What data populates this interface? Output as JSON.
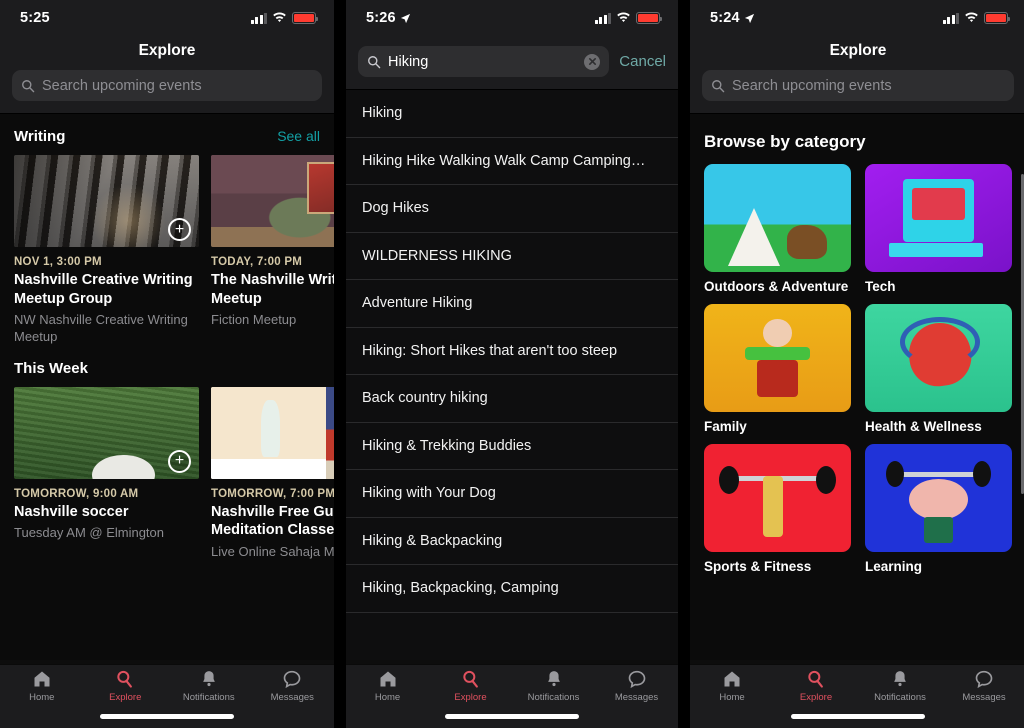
{
  "meta": {
    "app": "Meetup",
    "accent_red": "#e0515f",
    "accent_teal": "#13a0a5",
    "background": "#0b0b0b",
    "chrome": "#1c1c1e"
  },
  "panels": [
    {
      "id": "explore-home",
      "status": {
        "time": "5:25",
        "location_arrow": false,
        "signal": "cellular-icon",
        "wifi": "wifi-icon",
        "battery": "battery-low-icon"
      },
      "header": {
        "title": "Explore"
      },
      "search": {
        "placeholder": "Search upcoming events",
        "value": "",
        "icon": "search-icon"
      },
      "sections": [
        {
          "title": "Writing",
          "see_all": "See all",
          "cards": [
            {
              "when": "NOV 1, 3:00 PM",
              "title": "Nashville Creative Writing Meetup Group",
              "group": "NW Nashville Creative Writing Meetup",
              "art": "art-books",
              "has_add": true,
              "add_icon": "plus-circle-icon"
            },
            {
              "when": "TODAY, 7:00 PM",
              "title": "The Nashville Writing Meetup",
              "group": "Fiction Meetup",
              "art": "art-man",
              "has_add": false,
              "add_icon": "plus-circle-icon"
            }
          ]
        },
        {
          "title": "This Week",
          "see_all": "",
          "cards": [
            {
              "when": "TOMORROW, 9:00 AM",
              "title": "Nashville soccer",
              "group": "Tuesday AM @ Elmington",
              "art": "art-grass",
              "has_add": true,
              "add_icon": "plus-circle-icon"
            },
            {
              "when": "TOMORROW, 7:00 PM",
              "title": "Nashville Free Guided Meditation Classes",
              "group": "Live Online Sahaja M",
              "art": "art-yoga",
              "has_add": false,
              "add_icon": "plus-circle-icon"
            }
          ]
        }
      ],
      "tabbar": [
        {
          "label": "Home",
          "icon": "home-icon",
          "active": false
        },
        {
          "label": "Explore",
          "icon": "search-icon",
          "active": true
        },
        {
          "label": "Notifications",
          "icon": "bell-icon",
          "active": false
        },
        {
          "label": "Messages",
          "icon": "chat-bubble-icon",
          "active": false
        }
      ]
    },
    {
      "id": "search-suggestions",
      "status": {
        "time": "5:26",
        "location_arrow": true,
        "signal": "cellular-icon",
        "wifi": "wifi-icon",
        "battery": "battery-low-icon"
      },
      "header": {
        "title": ""
      },
      "search": {
        "placeholder": "Search upcoming events",
        "value": "Hiking",
        "icon": "search-icon",
        "clear_icon": "clear-circle-icon",
        "cancel_label": "Cancel"
      },
      "suggestions": [
        "Hiking",
        "Hiking Hike Walking Walk Camp Camping…",
        "Dog Hikes",
        "WILDERNESS HIKING",
        "Adventure Hiking",
        "Hiking: Short Hikes that aren't too steep",
        "Back country hiking",
        "Hiking & Trekking Buddies",
        "Hiking with Your Dog",
        "Hiking & Backpacking",
        "Hiking, Backpacking, Camping"
      ],
      "tabbar": [
        {
          "label": "Home",
          "icon": "home-icon",
          "active": false
        },
        {
          "label": "Explore",
          "icon": "search-icon",
          "active": true
        },
        {
          "label": "Notifications",
          "icon": "bell-icon",
          "active": false
        },
        {
          "label": "Messages",
          "icon": "chat-bubble-icon",
          "active": false
        }
      ]
    },
    {
      "id": "browse-categories",
      "status": {
        "time": "5:24",
        "location_arrow": true,
        "signal": "cellular-icon",
        "wifi": "wifi-icon",
        "battery": "battery-low-icon"
      },
      "header": {
        "title": "Explore"
      },
      "search": {
        "placeholder": "Search upcoming events",
        "value": "",
        "icon": "search-icon"
      },
      "categories_title": "Browse by category",
      "categories": [
        {
          "label": "Outdoors & Adventure",
          "art": "t-outdoors"
        },
        {
          "label": "Tech",
          "art": "t-tech"
        },
        {
          "label": "Family",
          "art": "t-family"
        },
        {
          "label": "Health & Wellness",
          "art": "t-health"
        },
        {
          "label": "Sports & Fitness",
          "art": "t-sports"
        },
        {
          "label": "Learning",
          "art": "t-learning"
        }
      ],
      "tabbar": [
        {
          "label": "Home",
          "icon": "home-icon",
          "active": false
        },
        {
          "label": "Explore",
          "icon": "search-icon",
          "active": true
        },
        {
          "label": "Notifications",
          "icon": "bell-icon",
          "active": false
        },
        {
          "label": "Messages",
          "icon": "chat-bubble-icon",
          "active": false
        }
      ]
    }
  ]
}
